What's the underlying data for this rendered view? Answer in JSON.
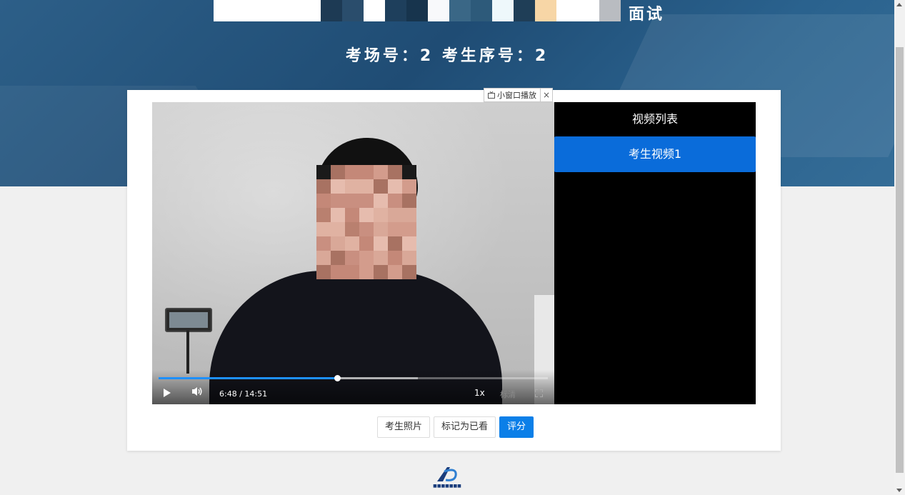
{
  "header": {
    "title_fragment": "面试",
    "exam_info": "考场号：2 考生序号：2"
  },
  "pip_bar": {
    "label": "小窗口播放",
    "close": "×"
  },
  "player": {
    "time": "6:48 / 14:51",
    "progress": 0.458,
    "buffered": 0.666,
    "rate": "1x",
    "quality": "标清"
  },
  "playlist": {
    "title": "视频列表",
    "items": [
      {
        "label": "考生视频1",
        "active": true
      }
    ]
  },
  "actions": {
    "photo": "考生照片",
    "mark_watched": "标记为已看",
    "score": "评分"
  },
  "colors": {
    "accent": "#0b7fe8",
    "playlist_active": "#0a6cda",
    "banner": "#2d5f88"
  }
}
